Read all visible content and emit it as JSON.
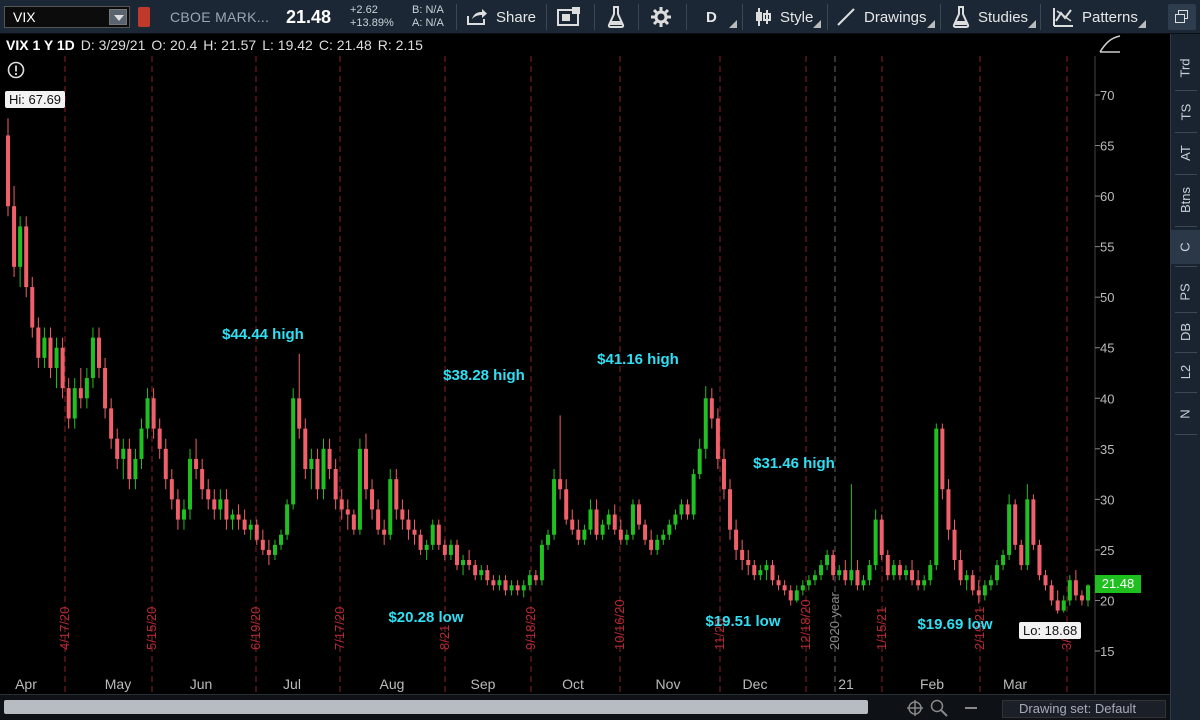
{
  "toolbar": {
    "symbol": "VIX",
    "description": "CBOE MARK...",
    "price": "21.48",
    "change_abs": "+2.62",
    "change_pct": "+13.89%",
    "bid": "B: N/A",
    "ask": "A: N/A",
    "share_label": "Share",
    "period_label": "D",
    "style_label": "Style",
    "drawings_label": "Drawings",
    "studies_label": "Studies",
    "patterns_label": "Patterns"
  },
  "chart_header": {
    "symbol": "VIX 1 Y 1D",
    "date": "D: 3/29/21",
    "open": "O: 20.4",
    "high": "H: 21.57",
    "low": "L: 19.42",
    "close": "C: 21.48",
    "range": "R: 2.15"
  },
  "right_tabs": [
    "Trd",
    "TS",
    "AT",
    "Btns",
    "C",
    "PS",
    "DB",
    "L2",
    "N"
  ],
  "drawing_set": "Drawing set: Default",
  "chart_data": {
    "type": "candlestick",
    "y_axis_ticks": [
      "70",
      "65",
      "60",
      "55",
      "50",
      "45",
      "40",
      "35",
      "30",
      "25",
      "20",
      "15"
    ],
    "ylim": [
      14,
      73
    ],
    "x_axis_labels": [
      "Apr",
      "May",
      "Jun",
      "Jul",
      "Aug",
      "Sep",
      "Oct",
      "Nov",
      "Dec",
      "21",
      "Feb",
      "Mar"
    ],
    "expiration_labels": [
      "4/17/20",
      "5/15/20",
      "6/19/20",
      "7/17/20",
      "8/21",
      "9/18/20",
      "10/16/20",
      "11/20",
      "12/18/20",
      "2020 year",
      "1/15/21",
      "2/19/21",
      "3/"
    ],
    "hi_label": "Hi: 67.69",
    "lo_label": "Lo: 18.68",
    "last_price": "21.48",
    "annotations": [
      "$44.44 high",
      "$38.28 high",
      "$41.16 high",
      "$31.46 high",
      "$20.28 low",
      "$19.51 low",
      "$19.69 low"
    ],
    "up_color": "#21c021",
    "down_color": "#f0606a",
    "annotation_color": "#2fe0f5",
    "candles": [
      [
        66.0,
        67.7,
        58.0,
        59.0
      ],
      [
        59.0,
        61.0,
        52.0,
        53.0
      ],
      [
        53.0,
        58.0,
        51.0,
        57.0
      ],
      [
        57.0,
        58.0,
        50.0,
        51.0
      ],
      [
        51.0,
        52.0,
        46.0,
        47.0
      ],
      [
        47.0,
        48.0,
        43.0,
        44.0
      ],
      [
        44.0,
        47.0,
        43.0,
        46.0
      ],
      [
        46.0,
        47.0,
        42.0,
        43.0
      ],
      [
        43.0,
        46.0,
        41.0,
        45.0
      ],
      [
        45.0,
        46.0,
        40.0,
        41.0
      ],
      [
        41.0,
        42.0,
        37.0,
        38.0
      ],
      [
        38.0,
        42.0,
        37.0,
        41.0
      ],
      [
        41.0,
        43.0,
        39.0,
        40.0
      ],
      [
        40.0,
        43.0,
        39.0,
        42.0
      ],
      [
        42.0,
        47.0,
        41.0,
        46.0
      ],
      [
        46.0,
        47.0,
        42.0,
        43.0
      ],
      [
        43.0,
        44.0,
        38.0,
        39.0
      ],
      [
        39.0,
        40.0,
        35.0,
        36.0
      ],
      [
        36.0,
        37.0,
        33.0,
        34.0
      ],
      [
        34.0,
        36.0,
        32.0,
        35.0
      ],
      [
        35.0,
        36.0,
        31.0,
        32.0
      ],
      [
        32.0,
        35.0,
        31.0,
        34.0
      ],
      [
        34.0,
        38.0,
        33.0,
        37.0
      ],
      [
        37.0,
        41.0,
        36.0,
        40.0
      ],
      [
        40.0,
        41.0,
        36.0,
        37.0
      ],
      [
        37.0,
        38.0,
        34.0,
        35.0
      ],
      [
        35.0,
        36.0,
        31.0,
        32.0
      ],
      [
        32.0,
        33.0,
        29.0,
        30.0
      ],
      [
        30.0,
        31.0,
        27.0,
        28.0
      ],
      [
        28.0,
        30.0,
        27.0,
        29.0
      ],
      [
        29.0,
        35.0,
        28.0,
        34.0
      ],
      [
        34.0,
        36.0,
        32.0,
        33.0
      ],
      [
        33.0,
        34.0,
        30.0,
        31.0
      ],
      [
        31.0,
        32.0,
        29.0,
        30.0
      ],
      [
        30.0,
        31.0,
        28.0,
        29.0
      ],
      [
        29.0,
        31.0,
        28.0,
        30.0
      ],
      [
        30.0,
        31.0,
        27.0,
        28.0
      ],
      [
        28.0,
        29.0,
        27.0,
        28.5
      ],
      [
        28.5,
        29.5,
        27.0,
        28.0
      ],
      [
        28.0,
        29.0,
        26.5,
        27.0
      ],
      [
        27.0,
        28.0,
        26.0,
        27.5
      ],
      [
        27.5,
        28.0,
        25.5,
        26.0
      ],
      [
        26.0,
        27.0,
        24.5,
        25.0
      ],
      [
        25.0,
        26.0,
        23.5,
        24.5
      ],
      [
        24.5,
        26.0,
        24.0,
        25.5
      ],
      [
        25.5,
        27.0,
        25.0,
        26.5
      ],
      [
        26.5,
        30.0,
        26.0,
        29.5
      ],
      [
        29.5,
        41.0,
        29.0,
        40.0
      ],
      [
        40.0,
        44.4,
        36.0,
        37.0
      ],
      [
        37.0,
        38.0,
        32.0,
        33.0
      ],
      [
        33.0,
        35.0,
        31.0,
        34.0
      ],
      [
        34.0,
        35.0,
        30.0,
        31.0
      ],
      [
        31.0,
        36.0,
        30.0,
        35.0
      ],
      [
        35.0,
        36.0,
        32.0,
        33.0
      ],
      [
        33.0,
        34.0,
        29.0,
        30.0
      ],
      [
        30.0,
        31.0,
        28.0,
        29.0
      ],
      [
        29.0,
        30.0,
        27.0,
        28.5
      ],
      [
        28.5,
        29.0,
        26.5,
        27.0
      ],
      [
        27.0,
        36.0,
        26.5,
        35.0
      ],
      [
        35.0,
        36.5,
        30.0,
        31.0
      ],
      [
        31.0,
        32.0,
        28.0,
        29.0
      ],
      [
        29.0,
        30.0,
        26.5,
        27.0
      ],
      [
        27.0,
        28.0,
        25.5,
        26.5
      ],
      [
        26.5,
        33.0,
        26.0,
        32.0
      ],
      [
        32.0,
        33.0,
        28.0,
        29.0
      ],
      [
        29.0,
        30.0,
        27.0,
        28.0
      ],
      [
        28.0,
        29.0,
        26.0,
        27.0
      ],
      [
        27.0,
        28.0,
        25.5,
        26.5
      ],
      [
        26.5,
        27.0,
        24.5,
        25.0
      ],
      [
        25.0,
        26.0,
        24.0,
        25.5
      ],
      [
        25.5,
        28.0,
        25.0,
        27.5
      ],
      [
        27.5,
        28.0,
        25.0,
        25.5
      ],
      [
        25.5,
        26.0,
        24.0,
        24.5
      ],
      [
        24.5,
        26.0,
        24.0,
        25.5
      ],
      [
        25.5,
        26.0,
        23.0,
        23.5
      ],
      [
        23.5,
        24.5,
        22.5,
        24.0
      ],
      [
        24.0,
        25.0,
        23.0,
        23.5
      ],
      [
        23.5,
        24.0,
        22.0,
        22.5
      ],
      [
        22.5,
        23.5,
        22.0,
        23.0
      ],
      [
        23.0,
        23.5,
        21.5,
        22.0
      ],
      [
        22.0,
        22.5,
        21.0,
        21.5
      ],
      [
        21.5,
        22.5,
        21.0,
        22.0
      ],
      [
        22.0,
        22.5,
        20.5,
        21.0
      ],
      [
        21.0,
        22.0,
        20.5,
        21.5
      ],
      [
        21.5,
        22.0,
        20.5,
        21.0
      ],
      [
        21.0,
        22.0,
        20.3,
        21.5
      ],
      [
        21.5,
        23.0,
        21.0,
        22.5
      ],
      [
        22.5,
        23.0,
        21.5,
        22.0
      ],
      [
        22.0,
        26.0,
        21.5,
        25.5
      ],
      [
        25.5,
        27.0,
        25.0,
        26.5
      ],
      [
        26.5,
        33.0,
        26.0,
        32.0
      ],
      [
        32.0,
        38.3,
        30.0,
        31.0
      ],
      [
        31.0,
        32.0,
        27.5,
        28.0
      ],
      [
        28.0,
        29.0,
        26.5,
        27.0
      ],
      [
        27.0,
        28.0,
        25.5,
        26.0
      ],
      [
        26.0,
        27.5,
        25.5,
        27.0
      ],
      [
        27.0,
        30.0,
        26.5,
        29.0
      ],
      [
        29.0,
        30.0,
        26.0,
        26.5
      ],
      [
        26.5,
        28.0,
        26.0,
        27.5
      ],
      [
        27.5,
        29.0,
        27.0,
        28.5
      ],
      [
        28.5,
        29.5,
        26.5,
        27.0
      ],
      [
        27.0,
        28.0,
        25.5,
        26.0
      ],
      [
        26.0,
        27.0,
        25.5,
        26.5
      ],
      [
        26.5,
        30.0,
        26.0,
        29.5
      ],
      [
        29.5,
        30.0,
        27.0,
        27.5
      ],
      [
        27.5,
        28.0,
        25.5,
        26.0
      ],
      [
        26.0,
        27.0,
        24.5,
        25.0
      ],
      [
        25.0,
        26.5,
        24.5,
        26.0
      ],
      [
        26.0,
        27.0,
        25.5,
        26.5
      ],
      [
        26.5,
        28.0,
        26.0,
        27.5
      ],
      [
        27.5,
        29.0,
        27.0,
        28.5
      ],
      [
        28.5,
        30.0,
        28.0,
        29.5
      ],
      [
        29.5,
        30.0,
        28.0,
        28.5
      ],
      [
        28.5,
        33.0,
        28.0,
        32.5
      ],
      [
        32.5,
        36.0,
        32.0,
        35.0
      ],
      [
        35.0,
        41.2,
        34.0,
        40.0
      ],
      [
        40.0,
        41.0,
        37.0,
        38.0
      ],
      [
        38.0,
        39.0,
        33.0,
        34.0
      ],
      [
        34.0,
        35.0,
        30.0,
        31.0
      ],
      [
        31.0,
        32.0,
        26.0,
        27.0
      ],
      [
        27.0,
        28.0,
        24.0,
        25.0
      ],
      [
        25.0,
        26.0,
        23.0,
        24.0
      ],
      [
        24.0,
        25.0,
        22.5,
        23.5
      ],
      [
        23.5,
        24.0,
        22.0,
        22.5
      ],
      [
        22.5,
        23.5,
        22.0,
        23.0
      ],
      [
        23.0,
        24.0,
        22.0,
        23.5
      ],
      [
        23.5,
        24.0,
        21.5,
        22.0
      ],
      [
        22.0,
        22.5,
        21.0,
        21.5
      ],
      [
        21.5,
        22.0,
        20.5,
        21.0
      ],
      [
        21.0,
        21.5,
        19.5,
        20.0
      ],
      [
        20.0,
        21.5,
        19.8,
        21.0
      ],
      [
        21.0,
        22.0,
        20.5,
        21.5
      ],
      [
        21.5,
        22.5,
        21.0,
        22.0
      ],
      [
        22.0,
        23.0,
        21.5,
        22.5
      ],
      [
        22.5,
        24.0,
        22.0,
        23.5
      ],
      [
        23.5,
        25.0,
        23.0,
        24.5
      ],
      [
        24.5,
        25.0,
        22.0,
        22.5
      ],
      [
        22.5,
        23.5,
        22.0,
        23.0
      ],
      [
        23.0,
        24.0,
        21.5,
        22.0
      ],
      [
        22.0,
        31.5,
        21.5,
        23.0
      ],
      [
        23.0,
        24.0,
        21.0,
        21.5
      ],
      [
        21.5,
        22.5,
        21.0,
        22.0
      ],
      [
        22.0,
        24.0,
        21.5,
        23.5
      ],
      [
        23.5,
        29.0,
        23.0,
        28.0
      ],
      [
        28.0,
        28.5,
        24.0,
        24.5
      ],
      [
        24.5,
        25.0,
        22.0,
        22.5
      ],
      [
        22.5,
        24.0,
        22.0,
        23.5
      ],
      [
        23.5,
        24.0,
        22.0,
        22.5
      ],
      [
        22.5,
        23.5,
        22.0,
        23.0
      ],
      [
        23.0,
        24.0,
        21.5,
        22.0
      ],
      [
        22.0,
        23.0,
        21.0,
        21.5
      ],
      [
        21.5,
        22.5,
        21.0,
        22.0
      ],
      [
        22.0,
        24.0,
        21.5,
        23.5
      ],
      [
        23.5,
        37.5,
        23.0,
        37.0
      ],
      [
        37.0,
        37.5,
        30.0,
        31.0
      ],
      [
        31.0,
        32.0,
        26.0,
        27.0
      ],
      [
        27.0,
        28.0,
        23.0,
        24.0
      ],
      [
        24.0,
        25.0,
        21.5,
        22.0
      ],
      [
        22.0,
        23.0,
        21.0,
        22.5
      ],
      [
        22.5,
        23.0,
        20.5,
        21.0
      ],
      [
        21.0,
        22.0,
        19.7,
        20.5
      ],
      [
        20.5,
        22.0,
        20.0,
        21.5
      ],
      [
        21.5,
        22.5,
        21.0,
        22.0
      ],
      [
        22.0,
        24.0,
        21.5,
        23.5
      ],
      [
        23.5,
        25.0,
        23.0,
        24.5
      ],
      [
        24.5,
        30.5,
        24.0,
        29.5
      ],
      [
        29.5,
        30.0,
        25.0,
        25.5
      ],
      [
        25.5,
        26.0,
        23.0,
        23.5
      ],
      [
        23.5,
        31.5,
        23.0,
        30.0
      ],
      [
        30.0,
        30.5,
        25.0,
        25.5
      ],
      [
        25.5,
        26.0,
        22.0,
        22.5
      ],
      [
        22.5,
        23.0,
        21.0,
        21.5
      ],
      [
        21.5,
        22.0,
        19.5,
        20.0
      ],
      [
        20.0,
        21.0,
        18.7,
        19.0
      ],
      [
        19.0,
        20.5,
        18.8,
        20.0
      ],
      [
        20.0,
        22.5,
        19.5,
        22.0
      ],
      [
        22.0,
        23.0,
        20.0,
        20.5
      ],
      [
        20.5,
        21.0,
        19.5,
        20.0
      ],
      [
        20.0,
        21.6,
        19.4,
        21.5
      ]
    ]
  }
}
